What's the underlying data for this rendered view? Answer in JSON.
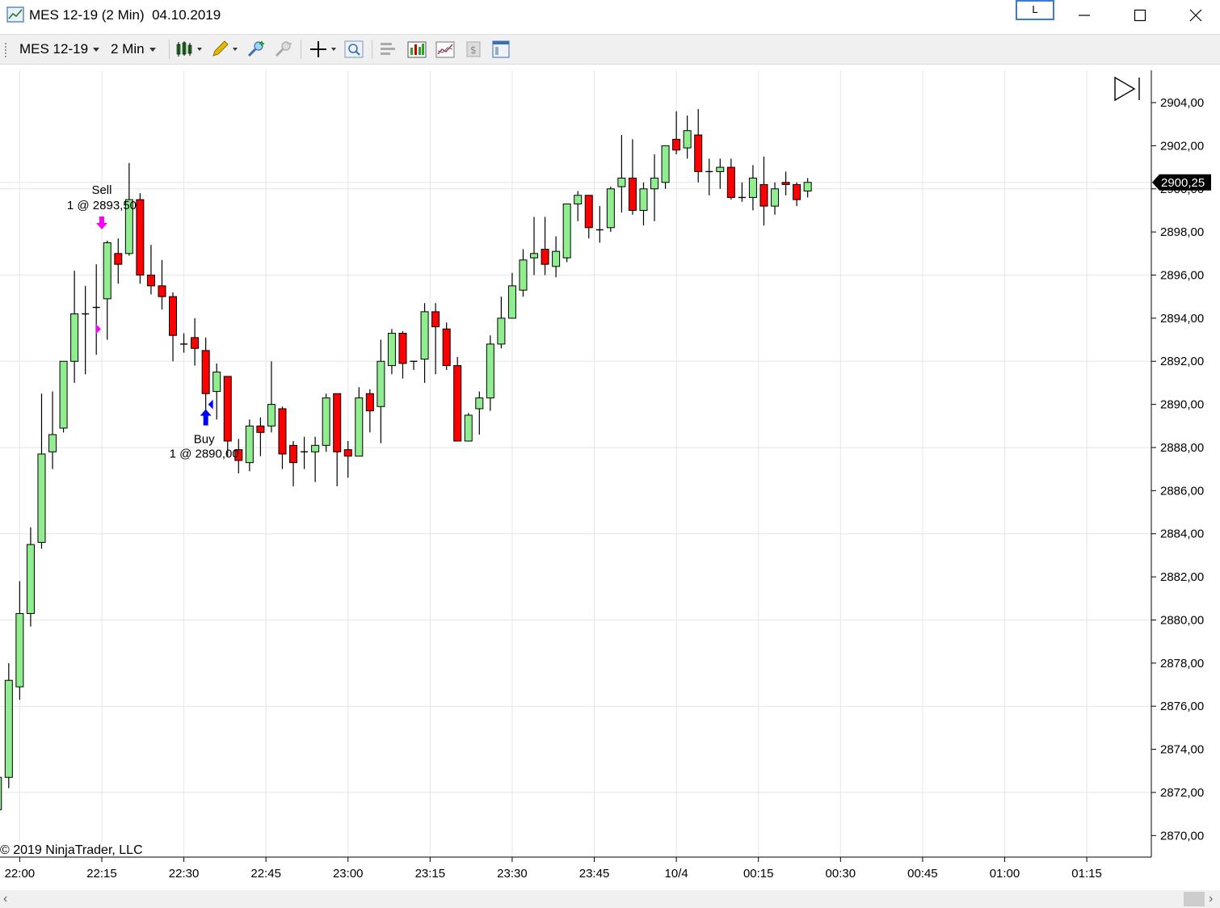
{
  "window": {
    "title": "MES 12-19 (2 Min)  04.10.2019",
    "link_label": "L"
  },
  "toolbar": {
    "instrument": "MES 12-19",
    "interval": "2 Min",
    "icons": [
      "chart-style-icon",
      "drawing-tool-icon",
      "zoom-in-icon",
      "zoom-out-icon",
      "crosshair-icon",
      "search-icon",
      "data-box-icon",
      "indicators-icon",
      "strategies-icon",
      "chart-trader-icon",
      "properties-icon"
    ]
  },
  "chart_data": {
    "type": "candlestick",
    "copyright": "© 2019 NinjaTrader, LLC",
    "last_price_label": "2900,25",
    "ylim": [
      2869,
      2905.5
    ],
    "y_ticks": [
      "2904,00",
      "2902,00",
      "2900,00",
      "2898,00",
      "2896,00",
      "2894,00",
      "2892,00",
      "2890,00",
      "2888,00",
      "2886,00",
      "2884,00",
      "2882,00",
      "2880,00",
      "2878,00",
      "2876,00",
      "2874,00",
      "2872,00",
      "2870,00"
    ],
    "y_tick_values": [
      2904,
      2902,
      2900,
      2898,
      2896,
      2894,
      2892,
      2890,
      2888,
      2886,
      2884,
      2882,
      2880,
      2878,
      2876,
      2874,
      2872,
      2870
    ],
    "x_ticks": [
      "22:00",
      "22:15",
      "22:30",
      "22:45",
      "23:00",
      "23:15",
      "23:30",
      "23:45",
      "10/4",
      "00:15",
      "00:30",
      "00:45",
      "01:00",
      "01:15"
    ],
    "x_tick_minutes": [
      0,
      15,
      30,
      45,
      60,
      75,
      90,
      105,
      120,
      135,
      150,
      165,
      180,
      195
    ],
    "x_range_minutes": [
      -3.6,
      206.8
    ],
    "grid": true,
    "candles": [
      {
        "t": -4,
        "o": 2871.2,
        "h": 2873.2,
        "l": 2870.9,
        "c": 2872.7
      },
      {
        "t": -2,
        "o": 2872.7,
        "h": 2878.0,
        "l": 2872.2,
        "c": 2877.2
      },
      {
        "t": 0,
        "o": 2876.9,
        "h": 2881.8,
        "l": 2876.3,
        "c": 2880.3
      },
      {
        "t": 2,
        "o": 2880.3,
        "h": 2884.3,
        "l": 2879.7,
        "c": 2883.5
      },
      {
        "t": 4,
        "o": 2883.6,
        "h": 2890.5,
        "l": 2883.3,
        "c": 2887.7
      },
      {
        "t": 6,
        "o": 2887.8,
        "h": 2890.6,
        "l": 2887.0,
        "c": 2888.6
      },
      {
        "t": 8,
        "o": 2888.9,
        "h": 2892.0,
        "l": 2888.7,
        "c": 2892.0
      },
      {
        "t": 10,
        "o": 2892.0,
        "h": 2896.2,
        "l": 2891.0,
        "c": 2894.2
      },
      {
        "t": 12,
        "o": 2894.2,
        "h": 2895.5,
        "l": 2891.4,
        "c": 2894.2
      },
      {
        "t": 14,
        "o": 2894.5,
        "h": 2896.5,
        "l": 2892.3,
        "c": 2894.5
      },
      {
        "t": 16,
        "o": 2894.9,
        "h": 2897.6,
        "l": 2893.0,
        "c": 2897.5
      },
      {
        "t": 18,
        "o": 2897.0,
        "h": 2897.7,
        "l": 2895.6,
        "c": 2896.5
      },
      {
        "t": 20,
        "o": 2897.0,
        "h": 2901.2,
        "l": 2896.9,
        "c": 2899.5
      },
      {
        "t": 22,
        "o": 2899.5,
        "h": 2899.8,
        "l": 2895.6,
        "c": 2896.0
      },
      {
        "t": 24,
        "o": 2896.0,
        "h": 2897.4,
        "l": 2895.1,
        "c": 2895.5
      },
      {
        "t": 26,
        "o": 2895.5,
        "h": 2896.7,
        "l": 2894.4,
        "c": 2895.0
      },
      {
        "t": 28,
        "o": 2895.0,
        "h": 2895.2,
        "l": 2892.0,
        "c": 2893.2
      },
      {
        "t": 30,
        "o": 2892.8,
        "h": 2893.3,
        "l": 2892.4,
        "c": 2892.8
      },
      {
        "t": 32,
        "o": 2893.1,
        "h": 2894.0,
        "l": 2891.8,
        "c": 2892.6
      },
      {
        "t": 34,
        "o": 2892.5,
        "h": 2893.1,
        "l": 2889.6,
        "c": 2890.5
      },
      {
        "t": 36,
        "o": 2890.6,
        "h": 2891.9,
        "l": 2889.3,
        "c": 2891.5
      },
      {
        "t": 38,
        "o": 2891.3,
        "h": 2891.3,
        "l": 2887.6,
        "c": 2888.3
      },
      {
        "t": 40,
        "o": 2887.9,
        "h": 2888.4,
        "l": 2886.8,
        "c": 2887.4
      },
      {
        "t": 42,
        "o": 2887.3,
        "h": 2889.3,
        "l": 2886.9,
        "c": 2889.0
      },
      {
        "t": 44,
        "o": 2889.0,
        "h": 2889.4,
        "l": 2887.6,
        "c": 2888.7
      },
      {
        "t": 46,
        "o": 2889.0,
        "h": 2892.0,
        "l": 2888.7,
        "c": 2890.0
      },
      {
        "t": 48,
        "o": 2889.8,
        "h": 2889.9,
        "l": 2887.0,
        "c": 2887.7
      },
      {
        "t": 50,
        "o": 2888.1,
        "h": 2888.3,
        "l": 2886.2,
        "c": 2887.3
      },
      {
        "t": 52,
        "o": 2887.8,
        "h": 2888.5,
        "l": 2887.0,
        "c": 2887.8
      },
      {
        "t": 54,
        "o": 2887.8,
        "h": 2888.5,
        "l": 2886.4,
        "c": 2888.1
      },
      {
        "t": 56,
        "o": 2888.1,
        "h": 2890.5,
        "l": 2887.8,
        "c": 2890.3
      },
      {
        "t": 58,
        "o": 2890.5,
        "h": 2890.5,
        "l": 2886.2,
        "c": 2887.8
      },
      {
        "t": 60,
        "o": 2887.9,
        "h": 2888.3,
        "l": 2886.6,
        "c": 2887.6
      },
      {
        "t": 62,
        "o": 2887.6,
        "h": 2890.8,
        "l": 2887.6,
        "c": 2890.3
      },
      {
        "t": 64,
        "o": 2890.5,
        "h": 2890.7,
        "l": 2888.7,
        "c": 2889.7
      },
      {
        "t": 66,
        "o": 2889.9,
        "h": 2893.0,
        "l": 2888.2,
        "c": 2892.0
      },
      {
        "t": 68,
        "o": 2891.8,
        "h": 2893.5,
        "l": 2891.4,
        "c": 2893.3
      },
      {
        "t": 70,
        "o": 2893.3,
        "h": 2893.4,
        "l": 2891.2,
        "c": 2891.9
      },
      {
        "t": 72,
        "o": 2892.0,
        "h": 2892.0,
        "l": 2891.6,
        "c": 2892.0
      },
      {
        "t": 74,
        "o": 2892.1,
        "h": 2894.7,
        "l": 2891.0,
        "c": 2894.3
      },
      {
        "t": 76,
        "o": 2894.3,
        "h": 2894.7,
        "l": 2891.4,
        "c": 2893.6
      },
      {
        "t": 78,
        "o": 2893.5,
        "h": 2893.8,
        "l": 2891.6,
        "c": 2891.8
      },
      {
        "t": 80,
        "o": 2891.8,
        "h": 2892.2,
        "l": 2888.3,
        "c": 2888.3
      },
      {
        "t": 82,
        "o": 2888.3,
        "h": 2889.6,
        "l": 2888.3,
        "c": 2889.5
      },
      {
        "t": 84,
        "o": 2889.8,
        "h": 2890.6,
        "l": 2888.6,
        "c": 2890.3
      },
      {
        "t": 86,
        "o": 2890.3,
        "h": 2893.2,
        "l": 2889.7,
        "c": 2892.8
      },
      {
        "t": 88,
        "o": 2892.8,
        "h": 2895.0,
        "l": 2892.6,
        "c": 2894.0
      },
      {
        "t": 90,
        "o": 2894.0,
        "h": 2896.1,
        "l": 2894.0,
        "c": 2895.5
      },
      {
        "t": 92,
        "o": 2895.3,
        "h": 2897.2,
        "l": 2895.0,
        "c": 2896.7
      },
      {
        "t": 94,
        "o": 2896.8,
        "h": 2898.7,
        "l": 2896.0,
        "c": 2897.0
      },
      {
        "t": 96,
        "o": 2897.2,
        "h": 2898.7,
        "l": 2896.0,
        "c": 2896.5
      },
      {
        "t": 98,
        "o": 2896.4,
        "h": 2897.8,
        "l": 2895.9,
        "c": 2897.1
      },
      {
        "t": 100,
        "o": 2896.8,
        "h": 2899.3,
        "l": 2896.6,
        "c": 2899.3
      },
      {
        "t": 102,
        "o": 2899.3,
        "h": 2899.9,
        "l": 2898.5,
        "c": 2899.7
      },
      {
        "t": 104,
        "o": 2899.7,
        "h": 2899.7,
        "l": 2897.7,
        "c": 2898.2
      },
      {
        "t": 106,
        "o": 2898.1,
        "h": 2899.2,
        "l": 2897.5,
        "c": 2898.1
      },
      {
        "t": 108,
        "o": 2898.2,
        "h": 2900.1,
        "l": 2898.0,
        "c": 2900.0
      },
      {
        "t": 110,
        "o": 2900.1,
        "h": 2902.5,
        "l": 2898.9,
        "c": 2900.5
      },
      {
        "t": 112,
        "o": 2900.5,
        "h": 2902.3,
        "l": 2898.8,
        "c": 2899.0
      },
      {
        "t": 114,
        "o": 2899.0,
        "h": 2900.3,
        "l": 2898.3,
        "c": 2900.0
      },
      {
        "t": 116,
        "o": 2900.0,
        "h": 2901.6,
        "l": 2898.5,
        "c": 2900.5
      },
      {
        "t": 118,
        "o": 2900.3,
        "h": 2902.0,
        "l": 2900.0,
        "c": 2902.0
      },
      {
        "t": 120,
        "o": 2902.3,
        "h": 2903.6,
        "l": 2901.6,
        "c": 2901.8
      },
      {
        "t": 122,
        "o": 2901.9,
        "h": 2903.4,
        "l": 2901.4,
        "c": 2902.7
      },
      {
        "t": 124,
        "o": 2902.5,
        "h": 2903.7,
        "l": 2900.3,
        "c": 2900.8
      },
      {
        "t": 126,
        "o": 2900.8,
        "h": 2901.4,
        "l": 2899.7,
        "c": 2900.8
      },
      {
        "t": 128,
        "o": 2900.8,
        "h": 2901.4,
        "l": 2900.0,
        "c": 2901.0
      },
      {
        "t": 130,
        "o": 2901.0,
        "h": 2901.4,
        "l": 2899.5,
        "c": 2899.6
      },
      {
        "t": 132,
        "o": 2899.6,
        "h": 2900.3,
        "l": 2899.4,
        "c": 2899.6
      },
      {
        "t": 134,
        "o": 2899.6,
        "h": 2901.1,
        "l": 2899.0,
        "c": 2900.5
      },
      {
        "t": 136,
        "o": 2900.2,
        "h": 2901.5,
        "l": 2898.3,
        "c": 2899.2
      },
      {
        "t": 138,
        "o": 2899.2,
        "h": 2900.3,
        "l": 2898.8,
        "c": 2900.0
      },
      {
        "t": 140,
        "o": 2900.3,
        "h": 2900.8,
        "l": 2899.7,
        "c": 2900.2
      },
      {
        "t": 142,
        "o": 2900.2,
        "h": 2900.3,
        "l": 2899.2,
        "c": 2899.5
      },
      {
        "t": 144,
        "o": 2899.9,
        "h": 2900.5,
        "l": 2899.6,
        "c": 2900.3
      }
    ],
    "executions": [
      {
        "type": "sell",
        "label": "Sell",
        "detail": "1 @ 2893,50",
        "t": 15,
        "price": 2893.5
      },
      {
        "type": "buy",
        "label": "Buy",
        "detail": "1 @ 2890,00",
        "t": 34,
        "price": 2890.0
      }
    ],
    "colors": {
      "up": "#90ee90",
      "down": "#ff0000",
      "wick": "#000000",
      "grid": "#e6e6e6",
      "sell_marker": "#ff00ff",
      "buy_marker": "#0000ff",
      "price_label_bg": "#000000"
    }
  }
}
